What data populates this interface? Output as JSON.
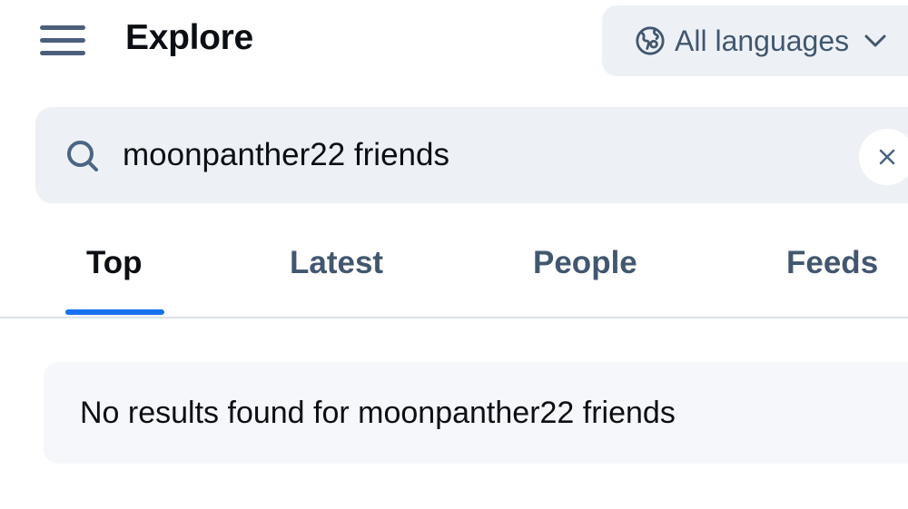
{
  "header": {
    "title": "Explore",
    "menu_icon": "hamburger-menu-icon",
    "language_button": {
      "label": "All languages",
      "icon": "globe-icon",
      "chevron_icon": "chevron-down-icon"
    }
  },
  "search": {
    "icon": "search-icon",
    "value": "moonpanther22 friends",
    "clear_icon": "close-icon"
  },
  "tabs": [
    {
      "label": "Top",
      "active": true
    },
    {
      "label": "Latest",
      "active": false
    },
    {
      "label": "People",
      "active": false
    },
    {
      "label": "Feeds",
      "active": false
    }
  ],
  "results": {
    "empty_message": "No results found for moonpanther22 friends"
  },
  "colors": {
    "accent": "#1872f0",
    "muted_text": "#42576f",
    "surface": "#edf1f6",
    "primary_text": "#0b0f14"
  }
}
